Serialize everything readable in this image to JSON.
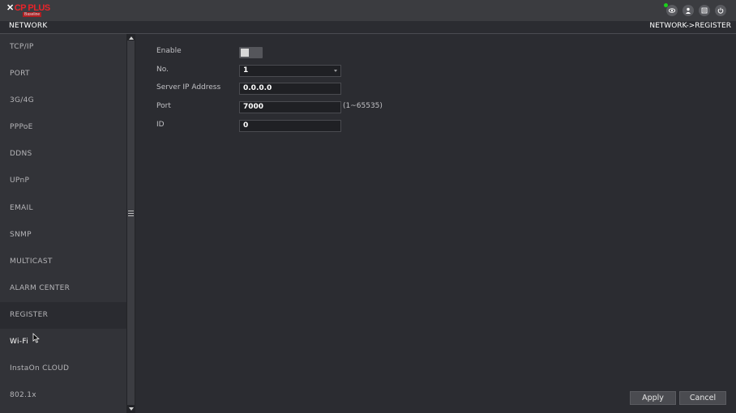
{
  "topbar": {
    "logo_brand": "CP PLUS",
    "logo_sub": "Baseline",
    "icons": [
      "eye-icon",
      "user-icon",
      "menu-icon",
      "power-icon"
    ]
  },
  "header": {
    "title": "NETWORK",
    "breadcrumb": "NETWORK->REGISTER"
  },
  "sidebar": {
    "items": [
      {
        "label": "TCP/IP"
      },
      {
        "label": "PORT"
      },
      {
        "label": "3G/4G"
      },
      {
        "label": "PPPoE"
      },
      {
        "label": "DDNS"
      },
      {
        "label": "UPnP"
      },
      {
        "label": "EMAIL"
      },
      {
        "label": "SNMP"
      },
      {
        "label": "MULTICAST"
      },
      {
        "label": "ALARM CENTER"
      },
      {
        "label": "REGISTER",
        "active": true
      },
      {
        "label": "Wi-Fi"
      },
      {
        "label": "InstaOn CLOUD"
      },
      {
        "label": "802.1x"
      }
    ]
  },
  "form": {
    "enable_label": "Enable",
    "enable_value": false,
    "no_label": "No.",
    "no_value": "1",
    "server_ip_label": "Server IP Address",
    "server_ip_value": "0.0.0.0",
    "port_label": "Port",
    "port_value": "7000",
    "port_hint": "(1~65535)",
    "id_label": "ID",
    "id_value": "0"
  },
  "buttons": {
    "apply": "Apply",
    "cancel": "Cancel"
  },
  "colors": {
    "brand": "#e8242a",
    "status_online": "#1bd11b",
    "background": "#2b2c31"
  }
}
